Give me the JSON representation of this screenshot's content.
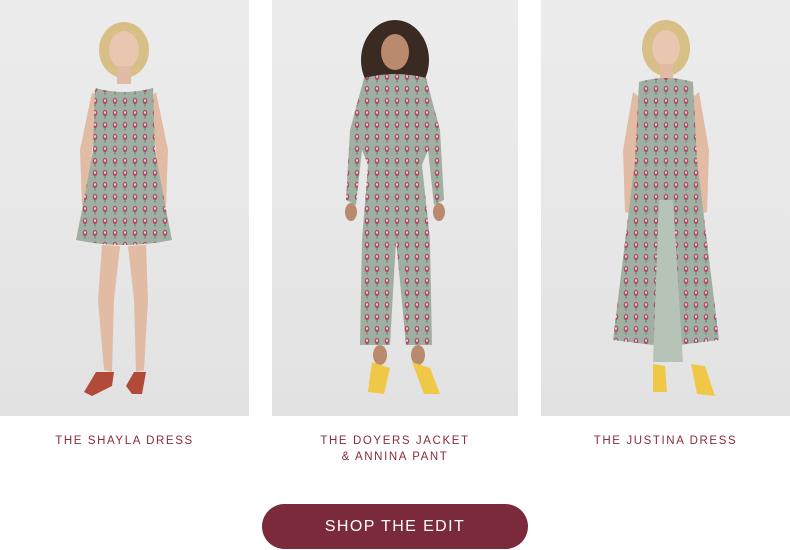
{
  "products": [
    {
      "name": "THE SHAYLA DRESS"
    },
    {
      "name": "THE DOYERS JACKET\n& ANNINA PANT"
    },
    {
      "name": "THE JUSTINA DRESS"
    }
  ],
  "cta": {
    "label": "SHOP THE EDIT"
  },
  "colors": {
    "caption": "#8b2a3c",
    "button": "#7a2a3a",
    "photo_bg": "#e8e8e8",
    "fabric": "#9fb0a2",
    "motif": "#a9506a"
  }
}
